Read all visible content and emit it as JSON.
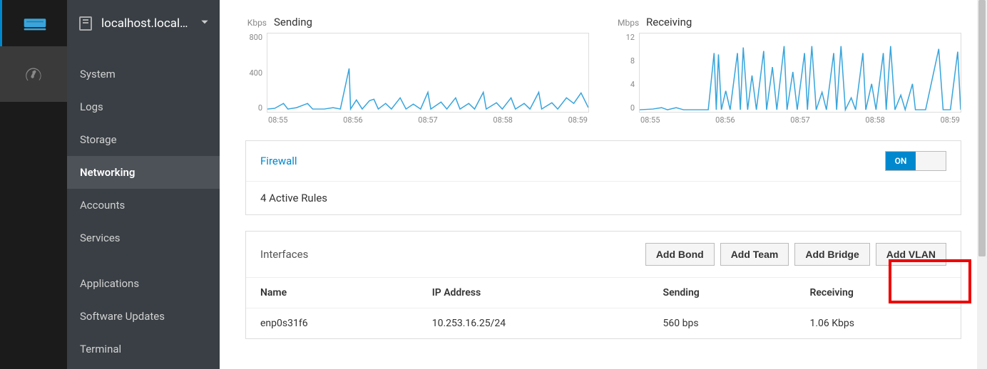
{
  "host": {
    "name": "localhost.local…"
  },
  "sidebar": {
    "items": [
      {
        "label": "System"
      },
      {
        "label": "Logs"
      },
      {
        "label": "Storage"
      },
      {
        "label": "Networking"
      },
      {
        "label": "Accounts"
      },
      {
        "label": "Services"
      }
    ],
    "items2": [
      {
        "label": "Applications"
      },
      {
        "label": "Software Updates"
      },
      {
        "label": "Terminal"
      }
    ],
    "active_index": 3
  },
  "charts": {
    "sending": {
      "unit": "Kbps",
      "title": "Sending",
      "y_ticks": [
        "800",
        "400",
        "0"
      ],
      "x_ticks": [
        "08:55",
        "08:56",
        "08:57",
        "08:58",
        "08:59"
      ]
    },
    "receiving": {
      "unit": "Mbps",
      "title": "Receiving",
      "y_ticks": [
        "12",
        "8",
        "4",
        "0"
      ],
      "x_ticks": [
        "08:55",
        "08:56",
        "08:57",
        "08:58",
        "08:59"
      ]
    }
  },
  "firewall": {
    "link": "Firewall",
    "toggle_on": "ON",
    "rules_text": "4 Active Rules"
  },
  "interfaces": {
    "title": "Interfaces",
    "buttons": {
      "bond": "Add Bond",
      "team": "Add Team",
      "bridge": "Add Bridge",
      "vlan": "Add VLAN"
    },
    "columns": {
      "name": "Name",
      "ip": "IP Address",
      "sending": "Sending",
      "receiving": "Receiving"
    },
    "rows": [
      {
        "name": "enp0s31f6",
        "ip": "10.253.16.25/24",
        "sending": "560 bps",
        "receiving": "1.06 Kbps"
      }
    ]
  },
  "chart_data": [
    {
      "type": "line",
      "title": "Sending",
      "xlabel": "",
      "ylabel": "Kbps",
      "ylim": [
        0,
        800
      ],
      "x_ticks": [
        "08:55",
        "08:56",
        "08:57",
        "08:58",
        "08:59"
      ],
      "series": [
        {
          "name": "Sending",
          "values_approx_kbps_baseline_with_spikes": {
            "baseline": 25,
            "spikes": [
              {
                "t": "08:55:15",
                "v": 60
              },
              {
                "t": "08:55:25",
                "v": 55
              },
              {
                "t": "08:55:45",
                "v": 440
              },
              {
                "t": "08:55:55",
                "v": 120
              },
              {
                "t": "08:56:05",
                "v": 100
              },
              {
                "t": "08:56:10",
                "v": 130
              },
              {
                "t": "08:56:20",
                "v": 55
              },
              {
                "t": "08:56:35",
                "v": 140
              },
              {
                "t": "08:56:45",
                "v": 50
              },
              {
                "t": "08:57:00",
                "v": 200
              },
              {
                "t": "08:57:20",
                "v": 80
              },
              {
                "t": "08:57:35",
                "v": 140
              },
              {
                "t": "08:57:50",
                "v": 60
              },
              {
                "t": "08:58:00",
                "v": 200
              },
              {
                "t": "08:58:20",
                "v": 70
              },
              {
                "t": "08:58:35",
                "v": 140
              },
              {
                "t": "08:58:50",
                "v": 60
              },
              {
                "t": "08:59:00",
                "v": 200
              }
            ]
          }
        }
      ]
    },
    {
      "type": "line",
      "title": "Receiving",
      "xlabel": "",
      "ylabel": "Mbps",
      "ylim": [
        0,
        12
      ],
      "x_ticks": [
        "08:55",
        "08:56",
        "08:57",
        "08:58",
        "08:59"
      ],
      "series": [
        {
          "name": "Receiving",
          "values_approx_mbps_baseline_with_spikes": {
            "baseline": 0.3,
            "spikes": [
              {
                "t": "08:55:10",
                "v": 0.5
              },
              {
                "t": "08:55:25",
                "v": 0.5
              },
              {
                "t": "08:55:40",
                "v": 9
              },
              {
                "t": "08:55:45",
                "v": 8.5
              },
              {
                "t": "08:55:55",
                "v": 3
              },
              {
                "t": "08:56:00",
                "v": 9
              },
              {
                "t": "08:56:08",
                "v": 10
              },
              {
                "t": "08:56:15",
                "v": 5
              },
              {
                "t": "08:56:25",
                "v": 9.5
              },
              {
                "t": "08:56:35",
                "v": 7
              },
              {
                "t": "08:56:45",
                "v": 10
              },
              {
                "t": "08:56:55",
                "v": 6
              },
              {
                "t": "08:57:05",
                "v": 9
              },
              {
                "t": "08:57:15",
                "v": 10
              },
              {
                "t": "08:57:25",
                "v": 3
              },
              {
                "t": "08:57:35",
                "v": 9
              },
              {
                "t": "08:57:45",
                "v": 10
              },
              {
                "t": "08:57:55",
                "v": 2
              },
              {
                "t": "08:58:05",
                "v": 9
              },
              {
                "t": "08:58:15",
                "v": 4
              },
              {
                "t": "08:58:25",
                "v": 9
              },
              {
                "t": "08:58:35",
                "v": 10
              },
              {
                "t": "08:58:45",
                "v": 2.5
              },
              {
                "t": "08:58:55",
                "v": 4
              },
              {
                "t": "08:59:00",
                "v": 9.5
              }
            ]
          }
        }
      ]
    }
  ]
}
